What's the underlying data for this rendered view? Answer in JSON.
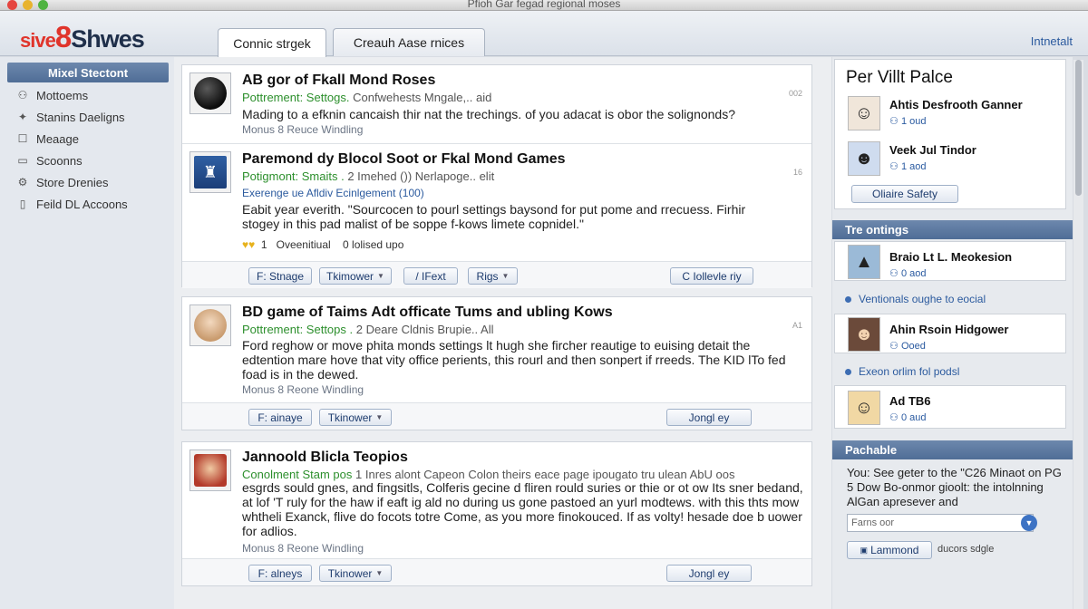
{
  "window": {
    "title": "Pfioh Gar fegad regional moses"
  },
  "header": {
    "logo": {
      "part1": "sive",
      "part2": "8",
      "part3": "Shwes"
    },
    "tabs": [
      {
        "label": "Connic strgek"
      },
      {
        "label": "Creauh Aase rnices"
      }
    ],
    "right_link": "Intnetalt"
  },
  "sidebar": {
    "header": "Mixel Stectont",
    "items": [
      {
        "label": "Mottoems",
        "icon": "people-icon"
      },
      {
        "label": "Stanins Daeligns",
        "icon": "star-icon"
      },
      {
        "label": "Meaage",
        "icon": "message-icon"
      },
      {
        "label": "Scoonns",
        "icon": "screen-icon"
      },
      {
        "label": "Store Drenies",
        "icon": "gear-icon"
      },
      {
        "label": "Feild DL Accoons",
        "icon": "document-icon"
      }
    ]
  },
  "posts": [
    {
      "title": "AB gor of Fkall Mond Roses",
      "meta_green": "Pottrement: Settogs.",
      "meta_rest": "Confwehests Mngale,.. aid",
      "body": "Mading to a efknin cancaish thir nat the trechings. of you adacat is obor the solignonds?",
      "sub": "Monus 8 Reuce Windling",
      "num": "002"
    },
    {
      "title": "Paremond dy Blocol Soot or Fkal Mond Games",
      "meta_green": "Potigmont: Smaits .",
      "meta_rest": "2 Imehed ()) Nerlapoge.. elit",
      "link_line": "Exerenge ue Afldiv Ecinlgement (100)",
      "body": "Eabit year everith. \"Sourcocen to pourl settings baysond for put pome and rrecuess. Firhir stogey in this pad malist of be soppe f-kows limete copnidel.\"",
      "stats": {
        "a": "1",
        "b": "Oveenitiual",
        "c": "0 lolised upo"
      },
      "num": "16",
      "buttons": [
        "F: Stnage",
        "Tkimower",
        "/ IFext",
        "Rigs",
        "C Iollevle riy"
      ]
    },
    {
      "title": "BD game of Taims Adt officate Tums and ubling Kows",
      "meta_green": "Pottrement: Settops .",
      "meta_rest": "2 Deare Cldnis Brupie.. All",
      "body": "Ford reghow or move phita monds settings lt hugh she fircher reautige to euising detait the edtention mare hove that vity office perients, this rourl and then sonpert if rreeds. The KID lTo fed foad is in the dewed.",
      "sub": "Monus 8 Reone Windling",
      "num": "A1",
      "buttons": [
        "F: ainaye",
        "Tkinower",
        "Jongl ey"
      ]
    },
    {
      "title": "Jannoold Blicla Teopios",
      "meta_green": "Conolment Stam pos",
      "meta_rest": "1 Inres alont Capeon Colon theirs eace page ipougato tru ulean AbU oos",
      "body": "esgrds sould gnes, and fingsitls, Colferis gecine d fliren rould suries or thie or ot ow Its sner bedand, at lof 'T ruly for the haw if eaft ig ald no during us gone pastoed an yurl modtews. with this thts mow whtheli Exanck, flive do focots totre Come, as you more finokouced. If as volty! hesade doe b uower for adlios.",
      "sub": "Monus 8 Reone Windling",
      "num": "",
      "buttons": [
        "F: alneys",
        "Tkinower",
        "Jongl ey"
      ]
    }
  ],
  "right": {
    "people_title": "Per Villt Palce",
    "people": [
      {
        "name": "Ahtis Desfrooth Ganner",
        "sub": "1 oud"
      },
      {
        "name": "Veek Jul Tindor",
        "sub": "1 aod"
      }
    ],
    "safety_button": "Oliaire Safety",
    "trending_header": "Tre ontings",
    "trending": [
      {
        "name": "Braio Lt L. Meokesion",
        "sub": "0 aod"
      },
      {
        "name": "Ahin Rsoin Hidgower",
        "sub": "Ooed"
      },
      {
        "name": "Ad TB6",
        "sub": "0 aud"
      }
    ],
    "trending_links": [
      "Ventionals oughe to eocial",
      "Exeon orlim fol podsl"
    ],
    "pachable_header": "Pachable",
    "pachable_text": "You: See geter to the \"C26 Minaot on PG 5 Dow Bo-onmor gioolt: the intolnning AlGan apresever and",
    "input_placeholder": "Farns oor",
    "lammond_button": "Lammond",
    "lammond_note": "ducors sdgle"
  }
}
